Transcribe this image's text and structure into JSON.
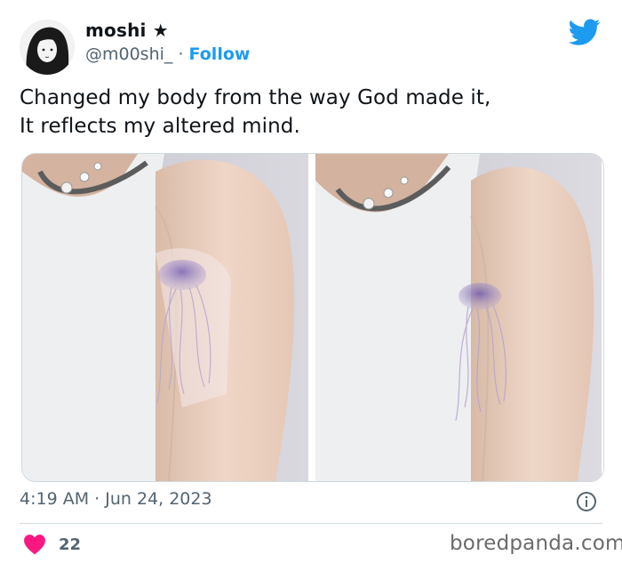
{
  "tweet": {
    "author": {
      "display_name": "moshi ★",
      "handle": "@m00shi_",
      "separator": "·",
      "follow_label": "Follow"
    },
    "text_lines": [
      "Changed my body from the way God made it,",
      "It reflects my altered mind."
    ],
    "timestamp": "4:19 AM · Jun 24, 2023",
    "like_count": "22"
  },
  "icons": {
    "brand": "twitter-bird-icon",
    "info": "info-icon",
    "like": "heart-icon"
  },
  "colors": {
    "brand_blue": "#1d9bf0",
    "heart_red": "#f91880",
    "muted_text": "#536471"
  },
  "watermark": "boredpanda.com"
}
